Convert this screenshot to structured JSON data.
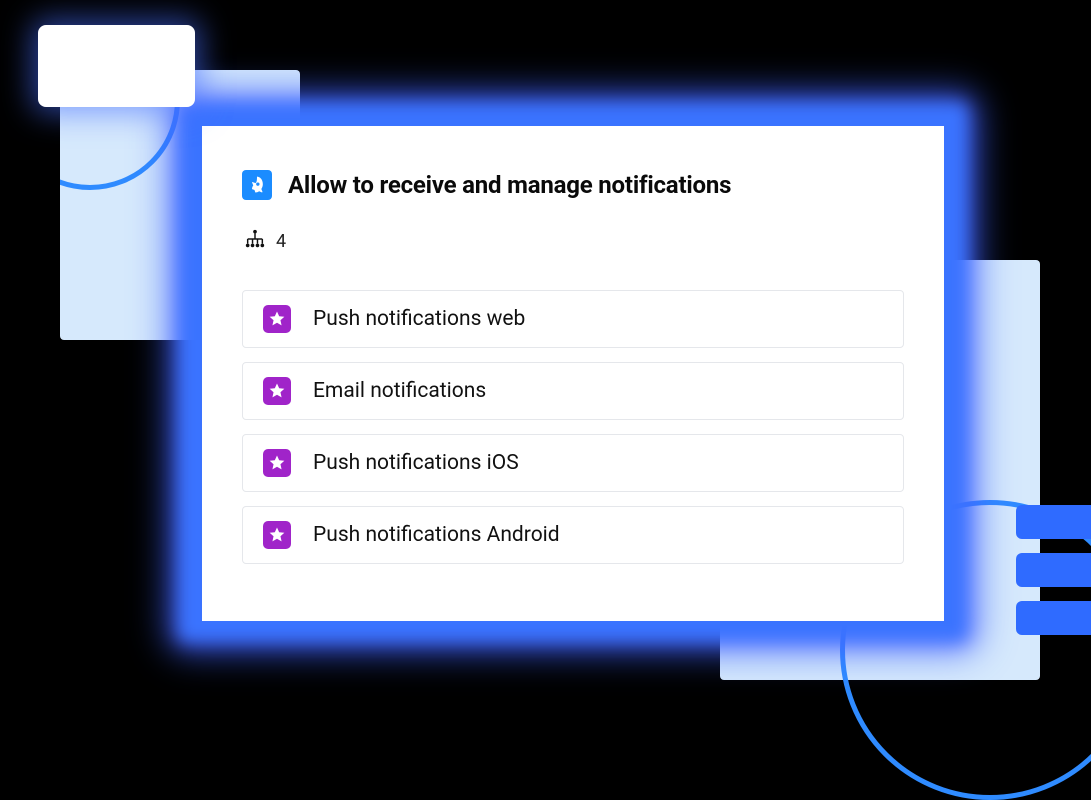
{
  "card": {
    "title": "Allow to receive and manage notifications",
    "child_count": "4",
    "items": [
      {
        "label": "Push notifications web"
      },
      {
        "label": "Email notifications"
      },
      {
        "label": "Push notifications iOS"
      },
      {
        "label": "Push notifications Android"
      }
    ]
  }
}
